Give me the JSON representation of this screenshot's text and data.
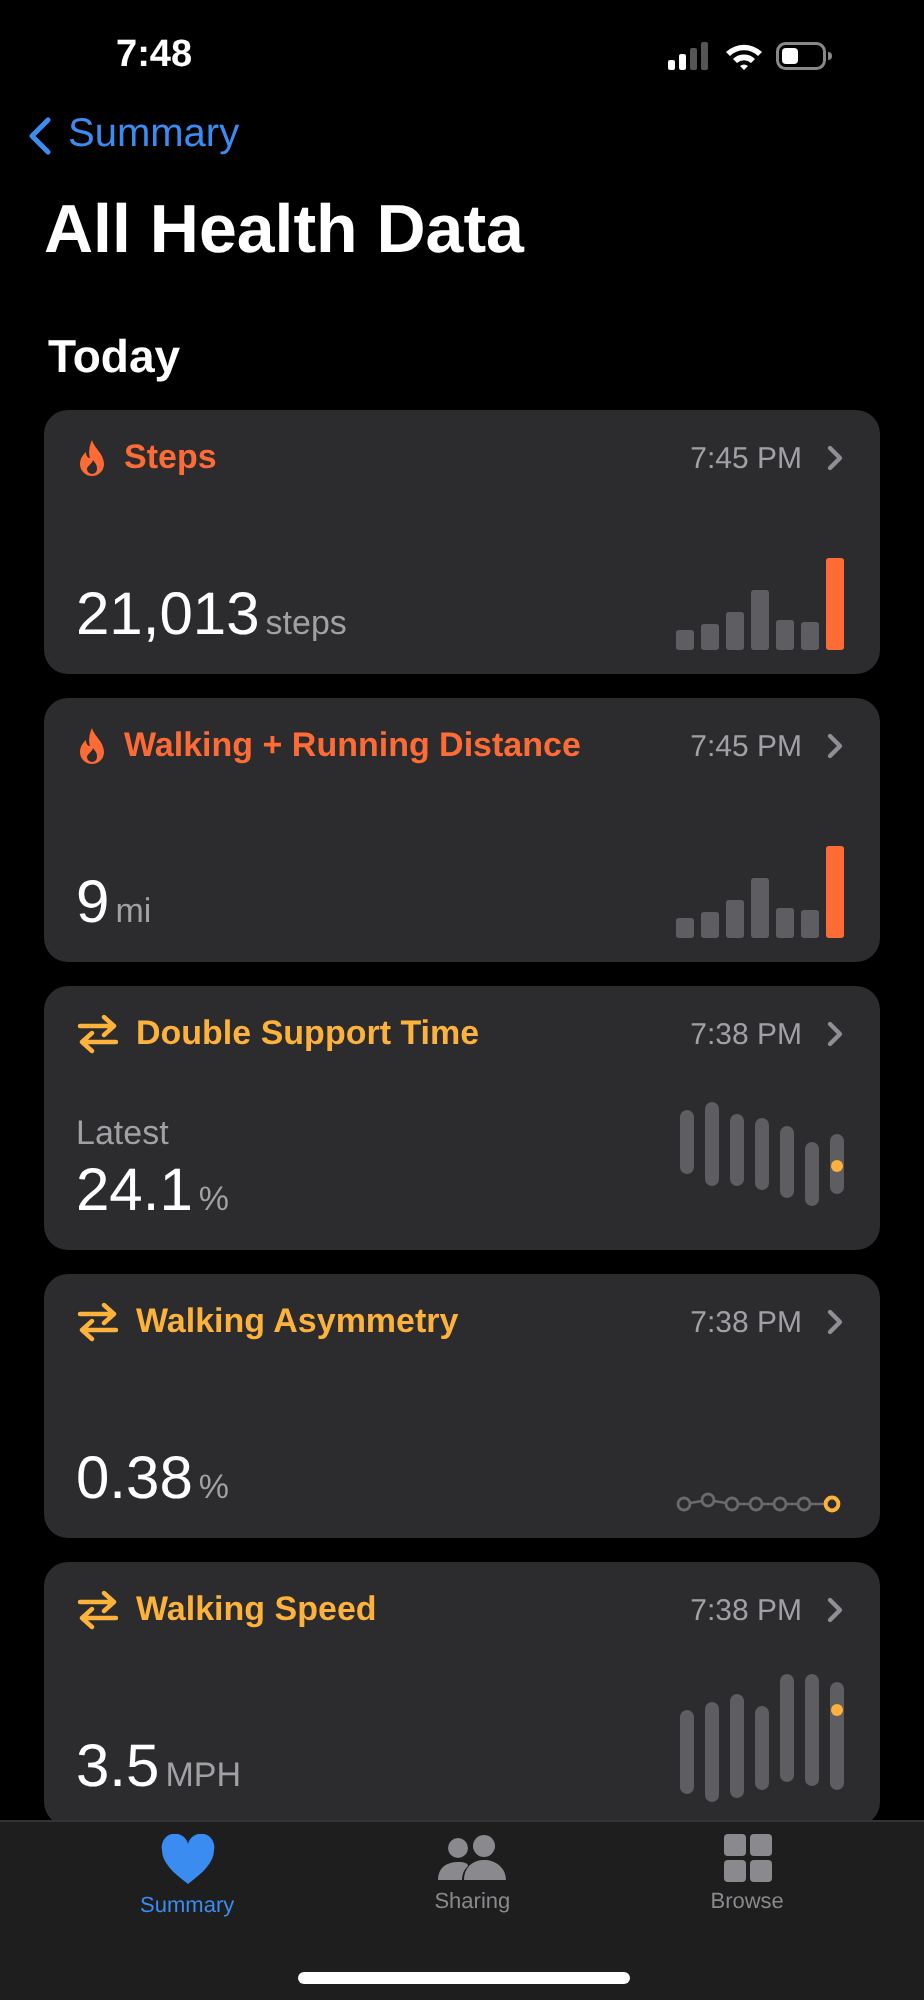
{
  "status_bar": {
    "time": "7:48"
  },
  "nav": {
    "back_label": "Summary",
    "title": "All Health Data"
  },
  "section": "Today",
  "metrics": [
    {
      "kind": "bars",
      "title": "Steps",
      "color": "#ff6b35",
      "time": "7:45 PM",
      "value": "21,013",
      "unit": "steps"
    },
    {
      "kind": "bars",
      "title": "Walking + Running Distance",
      "color": "#ff6b35",
      "time": "7:45 PM",
      "value": "9",
      "unit": "mi"
    },
    {
      "kind": "range",
      "title": "Double Support Time",
      "color": "#fdb23c",
      "time": "7:38 PM",
      "caption": "Latest",
      "value": "24.1",
      "unit": "%"
    },
    {
      "kind": "dots",
      "title": "Walking Asymmetry",
      "color": "#fdb23c",
      "time": "7:38 PM",
      "value": "0.38",
      "unit": "%"
    },
    {
      "kind": "range",
      "title": "Walking Speed",
      "color": "#fdb23c",
      "time": "7:38 PM",
      "value": "3.5",
      "unit": "MPH"
    }
  ],
  "tabs": [
    {
      "label": "Summary",
      "selected": true
    },
    {
      "label": "Sharing",
      "selected": false
    },
    {
      "label": "Browse",
      "selected": false
    }
  ]
}
